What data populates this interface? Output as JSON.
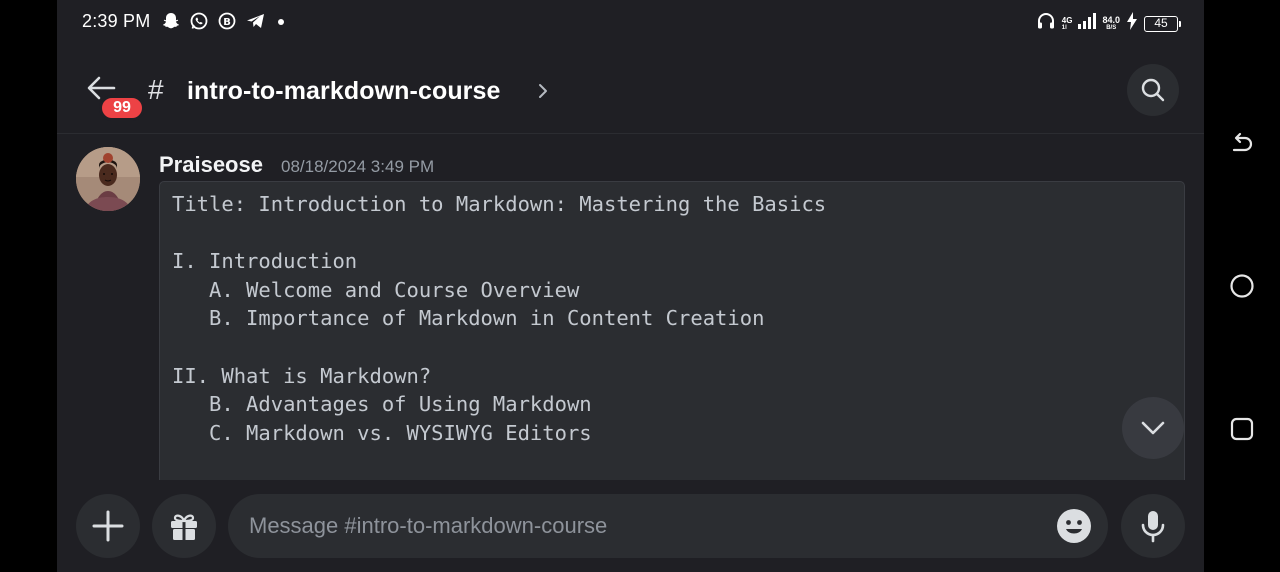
{
  "status_bar": {
    "time": "2:39 PM",
    "network_tag_top": "4G",
    "network_tag_bottom": "1l",
    "net_speed_value": "84.0",
    "net_speed_unit": "B/S",
    "battery_level": "45"
  },
  "header": {
    "unread_count": "99",
    "hash_symbol": "#",
    "channel_name": "intro-to-markdown-course"
  },
  "message": {
    "author": "Praiseose",
    "timestamp": "08/18/2024 3:49 PM",
    "code_lines": [
      "Title: Introduction to Markdown: Mastering the Basics",
      "",
      "I. Introduction",
      "   A. Welcome and Course Overview",
      "   B. Importance of Markdown in Content Creation",
      "",
      "II. What is Markdown?",
      "   B. Advantages of Using Markdown",
      "   C. Markdown vs. WYSIWYG Editors",
      "",
      ""
    ]
  },
  "composer": {
    "placeholder": "Message #intro-to-markdown-course"
  },
  "colors": {
    "background": "#1f1f24",
    "surface": "#2b2d31",
    "badge": "#ed4245",
    "text": "#f2f3f5",
    "muted": "#949ba4"
  },
  "icons": {
    "status_left": [
      "snapchat-icon",
      "whatsapp-icon",
      "whatsapp-business-icon",
      "telegram-icon",
      "dot-icon"
    ],
    "status_right": [
      "headphones-icon",
      "signal-icon",
      "charging-icon",
      "battery-icon"
    ],
    "header": [
      "back-arrow-icon",
      "chevron-right-icon",
      "search-icon"
    ],
    "composer": [
      "plus-icon",
      "gift-icon",
      "emoji-icon",
      "microphone-icon"
    ],
    "navigation": [
      "back-nav-icon",
      "home-nav-icon",
      "recents-nav-icon"
    ]
  }
}
